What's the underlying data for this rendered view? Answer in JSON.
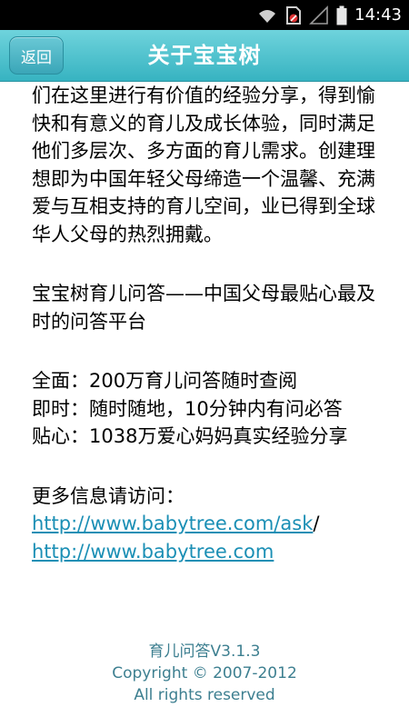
{
  "status_bar": {
    "time": "14:43",
    "icons": [
      "wifi-icon",
      "no-sim-icon",
      "signal-icon",
      "battery-icon"
    ]
  },
  "header": {
    "back_label": "返回",
    "title": "关于宝宝树"
  },
  "content": {
    "intro": "们在这里进行有价值的经验分享，得到愉快和有意义的育儿及成长体验，同时满足他们多层次、多方面的育儿需求。创建理想即为中国年轻父母缔造一个温馨、充满爱与互相支持的育儿空间，业已得到全球华人父母的热烈拥戴。",
    "slogan": "宝宝树育儿问答——中国父母最贴心最及时的问答平台",
    "features": [
      "全面：200万育儿问答随时查阅",
      "即时：随时随地，10分钟内有问必答",
      "贴心：1038万爱心妈妈真实经验分享"
    ],
    "more_info_label": "更多信息请访问：",
    "link_ask": "http://www.babytree.com/ask",
    "link_separator": "/",
    "link_home": "http://www.babytree.com"
  },
  "footer": {
    "version": "育儿问答V3.1.3",
    "copyright": "Copyright © 2007-2012",
    "rights": "All rights reserved"
  },
  "colors": {
    "header": "#3fb9c7",
    "link": "#1b8fb5",
    "footer_text": "#3d7f90"
  }
}
